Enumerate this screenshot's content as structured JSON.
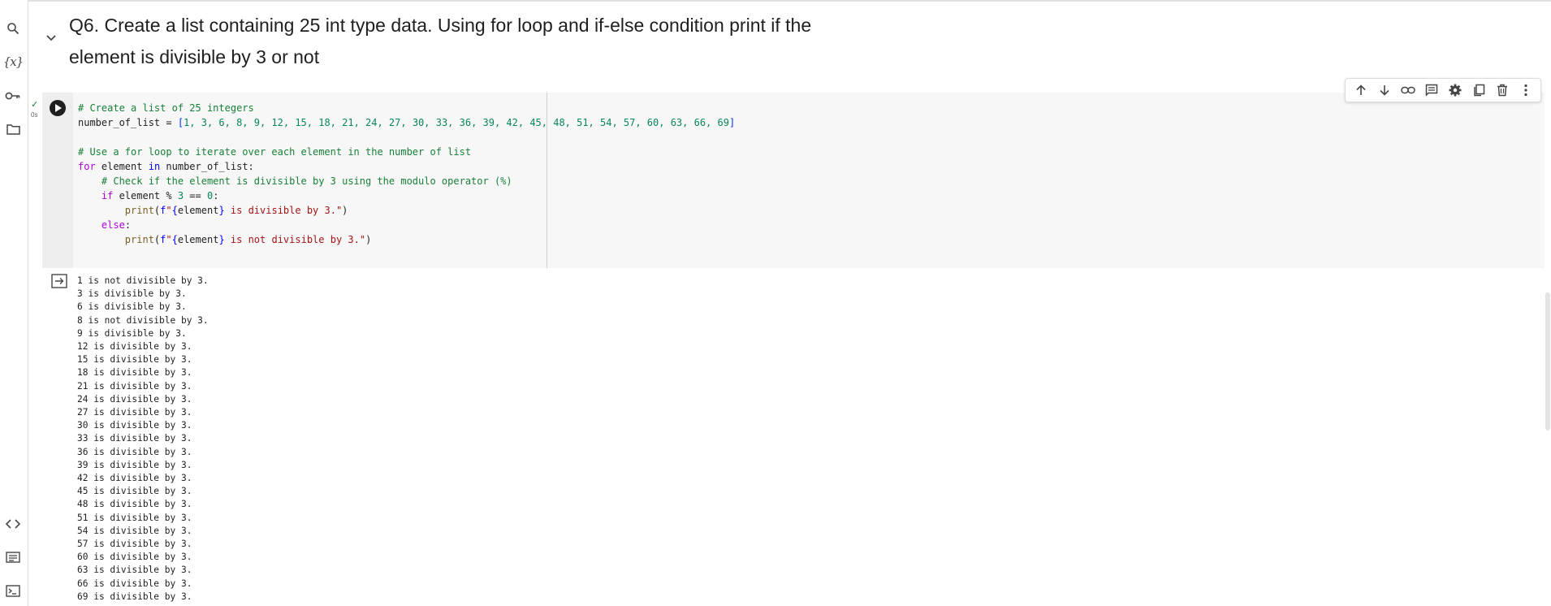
{
  "markdown_cell": {
    "heading": "Q6. Create a list containing 25 int type data. Using for loop and if-else condition print if the element is divisible by 3 or not"
  },
  "code_cell": {
    "exec_status": "✓",
    "exec_time": "0s",
    "code_lines": [
      "# Create a list of 25 integers",
      "number_of_list = [1, 3, 6, 8, 9, 12, 15, 18, 21, 24, 27, 30, 33, 36, 39, 42, 45, 48, 51, 54, 57, 60, 63, 66, 69]",
      "",
      "# Use a for loop to iterate over each element in the number of list",
      "for element in number_of_list:",
      "    # Check if the element is divisible by 3 using the modulo operator (%)",
      "    if element % 3 == 0:",
      "        print(f\"{element} is divisible by 3.\")",
      "    else:",
      "        print(f\"{element} is not divisible by 3.\")"
    ]
  },
  "toolbar": {
    "icons": [
      "arrow-up-icon",
      "arrow-down-icon",
      "link-icon",
      "comment-icon",
      "gear-icon",
      "mirror-cell-icon",
      "trash-icon",
      "more-vert-icon"
    ]
  },
  "output": {
    "lines": [
      "1 is not divisible by 3.",
      "3 is divisible by 3.",
      "6 is divisible by 3.",
      "8 is not divisible by 3.",
      "9 is divisible by 3.",
      "12 is divisible by 3.",
      "15 is divisible by 3.",
      "18 is divisible by 3.",
      "21 is divisible by 3.",
      "24 is divisible by 3.",
      "27 is divisible by 3.",
      "30 is divisible by 3.",
      "33 is divisible by 3.",
      "36 is divisible by 3.",
      "39 is divisible by 3.",
      "42 is divisible by 3.",
      "45 is divisible by 3.",
      "48 is divisible by 3.",
      "51 is divisible by 3.",
      "54 is divisible by 3.",
      "57 is divisible by 3.",
      "60 is divisible by 3.",
      "63 is divisible by 3.",
      "66 is divisible by 3.",
      "69 is divisible by 3."
    ]
  },
  "sidebar": {
    "icons": [
      "search-icon",
      "variables-icon",
      "key-icon",
      "folder-icon",
      "code-snippets-icon",
      "command-palette-icon",
      "terminal-icon"
    ],
    "variables_glyph": "{x}"
  },
  "colors": {
    "comment": "#188038",
    "keyword": "#af00db",
    "number": "#098658",
    "string": "#a31515"
  }
}
